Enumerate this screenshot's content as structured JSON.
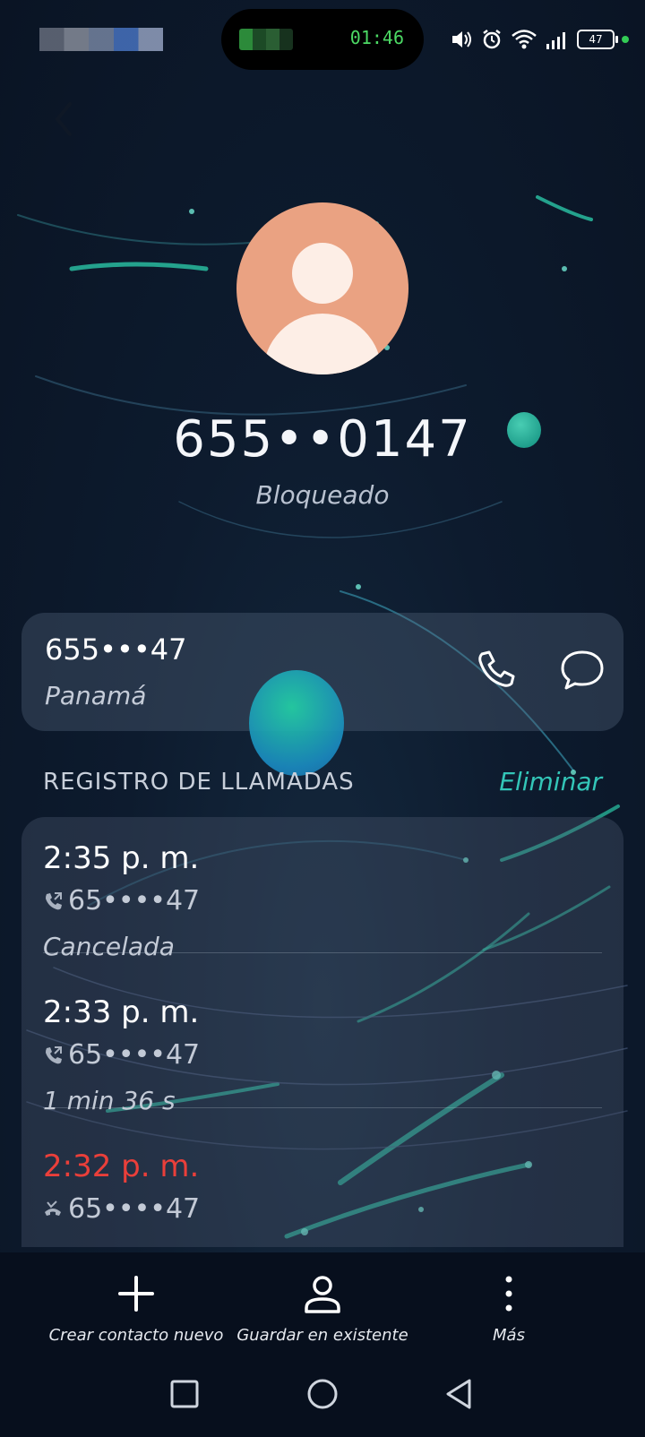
{
  "status_bar": {
    "time": "01:46",
    "battery": "47"
  },
  "contact": {
    "number": "655••0147",
    "state": "Bloqueado"
  },
  "number_card": {
    "number": "655•••47",
    "country": "Panamá"
  },
  "call_log": {
    "title": "REGISTRO DE LLAMADAS",
    "delete_label": "Eliminar",
    "entries": [
      {
        "time": "2:35 p. m.",
        "number": "65••••47",
        "status": "Cancelada",
        "type": "outgoing"
      },
      {
        "time": "2:33 p. m.",
        "number": "65••••47",
        "status": "1 min 36 s",
        "type": "outgoing"
      },
      {
        "time": "2:32 p. m.",
        "number": "65••••47",
        "status": "",
        "type": "missed"
      }
    ]
  },
  "bottom_actions": {
    "create": "Crear contacto nuevo",
    "save_existing": "Guardar en existente",
    "more": "Más"
  },
  "colors": {
    "accent": "#33c6b8",
    "missed": "#ea3f3a",
    "avatar_bg": "#eaa282"
  }
}
